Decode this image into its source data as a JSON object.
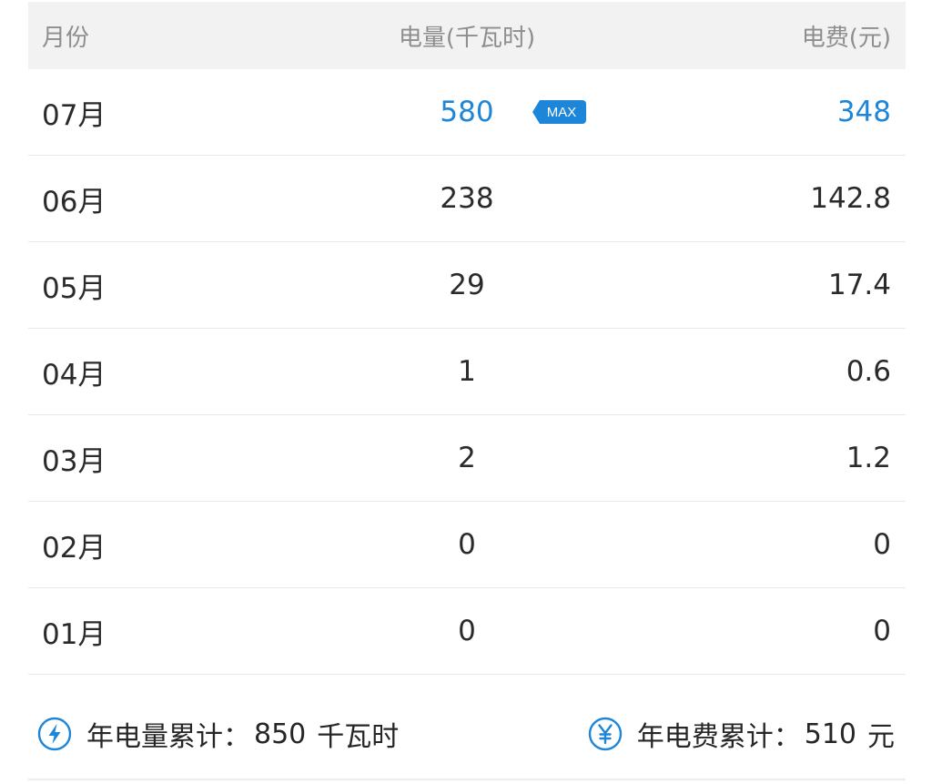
{
  "header": {
    "month": "月份",
    "usage": "电量(千瓦时)",
    "fee": "电费(元)"
  },
  "rows": [
    {
      "month": "07月",
      "usage": "580",
      "fee": "348",
      "badge": "MAX"
    },
    {
      "month": "06月",
      "usage": "238",
      "fee": "142.8"
    },
    {
      "month": "05月",
      "usage": "29",
      "fee": "17.4"
    },
    {
      "month": "04月",
      "usage": "1",
      "fee": "0.6"
    },
    {
      "month": "03月",
      "usage": "2",
      "fee": "1.2"
    },
    {
      "month": "02月",
      "usage": "0",
      "fee": "0"
    },
    {
      "month": "01月",
      "usage": "0",
      "fee": "0"
    }
  ],
  "summary": {
    "usage_label": "年电量累计：",
    "usage_value": "850",
    "usage_unit": "千瓦时",
    "usage_icon": "lightning-icon",
    "fee_label": "年电费累计：",
    "fee_value": "510",
    "fee_unit": "元",
    "fee_icon": "yuan-icon"
  },
  "colors": {
    "accent": "#1d86d8",
    "header_bg": "#f2f2f2",
    "text": "#2a2a2a",
    "header_text": "#8e8e8e"
  }
}
